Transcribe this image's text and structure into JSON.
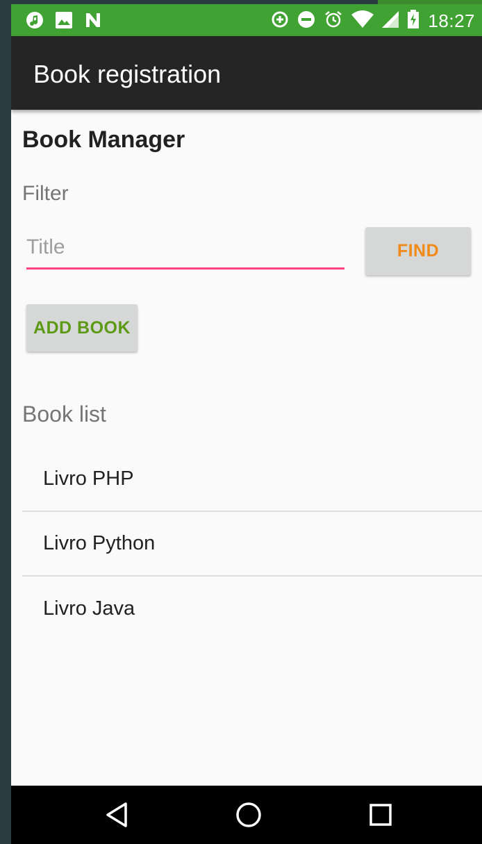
{
  "status_bar": {
    "time": "18:27",
    "left_icons": [
      "music-note-icon",
      "image-icon",
      "n-notification-icon"
    ],
    "right_icons": [
      "data-saver-icon",
      "do-not-disturb-icon",
      "alarm-clock-icon",
      "wifi-icon",
      "cell-signal-icon",
      "battery-icon"
    ],
    "color": "#3fa232"
  },
  "app_bar": {
    "title": "Book registration",
    "color": "#252525"
  },
  "main": {
    "heading": "Book Manager",
    "filter_label": "Filter",
    "title_input": {
      "placeholder": "Title",
      "value": ""
    },
    "find_button": "FIND",
    "add_book_button": "ADD BOOK",
    "book_list_label": "Book list",
    "books": [
      "Livro PHP",
      "Livro Python",
      "Livro Java"
    ]
  },
  "colors": {
    "accent": "#ff4081",
    "find_text": "#f18a18",
    "add_text": "#5c9a16"
  },
  "nav_bar": {
    "icons": [
      "back-icon",
      "home-icon",
      "recents-icon"
    ]
  }
}
